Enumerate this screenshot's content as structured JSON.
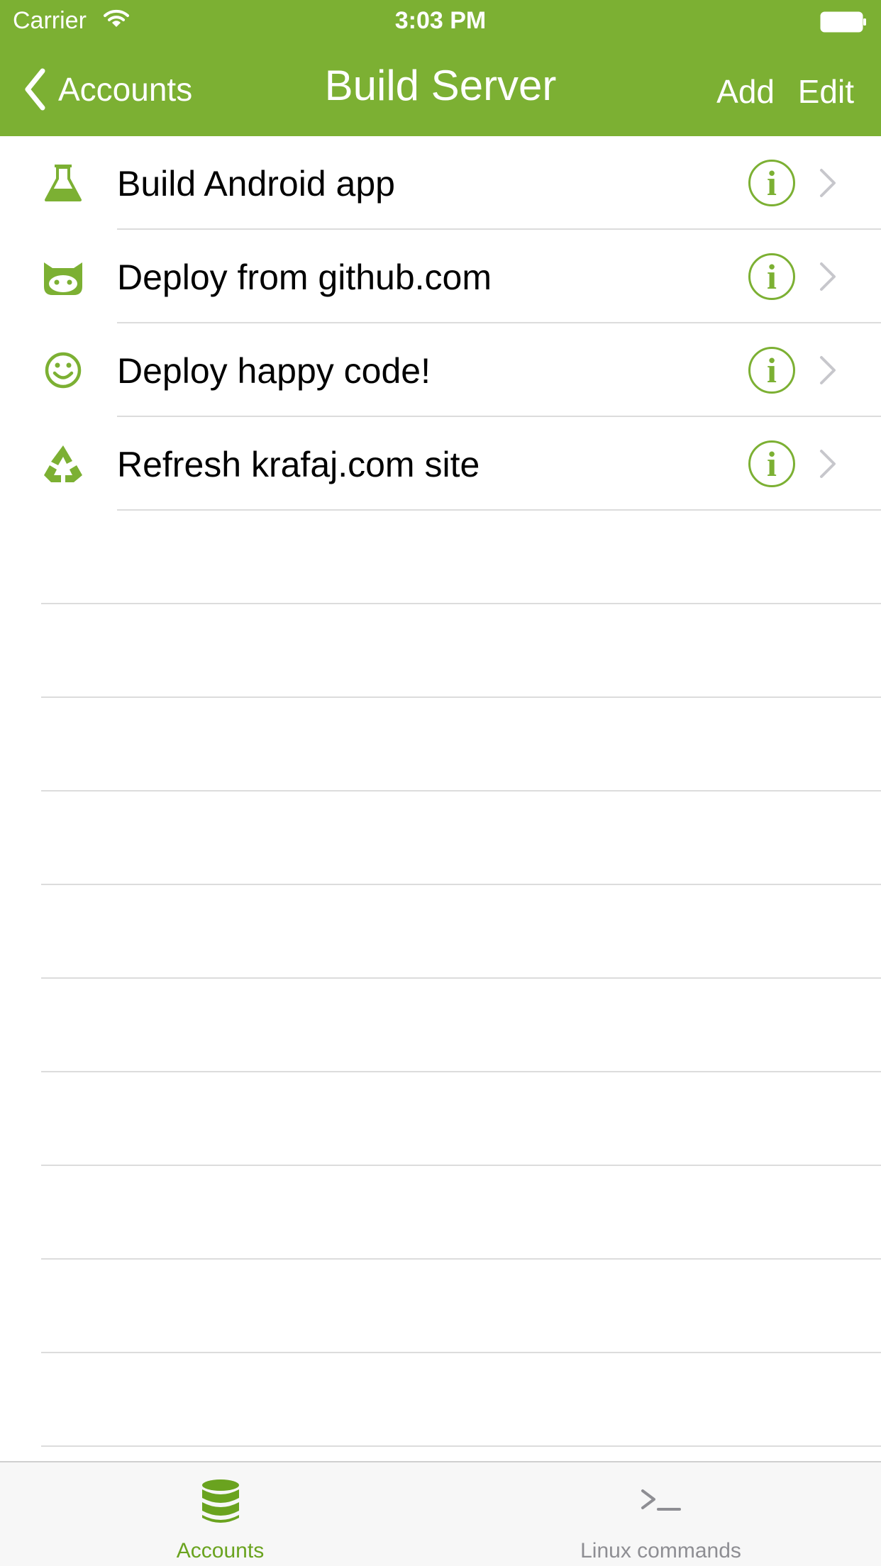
{
  "colors": {
    "accent": "#7cb033",
    "separator": "#dcdcdc",
    "tab_inactive": "#8e8e93"
  },
  "status_bar": {
    "carrier": "Carrier",
    "time": "3:03 PM"
  },
  "nav": {
    "back_label": "Accounts",
    "title": "Build Server",
    "add_label": "Add",
    "edit_label": "Edit"
  },
  "list": {
    "items": [
      {
        "label": "Build Android app",
        "icon": "flask-icon"
      },
      {
        "label": "Deploy from github.com",
        "icon": "github-cat-icon"
      },
      {
        "label": "Deploy happy code!",
        "icon": "smiley-icon"
      },
      {
        "label": "Refresh krafaj.com site",
        "icon": "recycle-icon"
      }
    ],
    "info_glyph": "i"
  },
  "tab_bar": {
    "tabs": [
      {
        "label": "Accounts",
        "icon": "database-icon",
        "selected": true
      },
      {
        "label": "Linux commands",
        "icon": "terminal-icon",
        "selected": false
      }
    ]
  }
}
